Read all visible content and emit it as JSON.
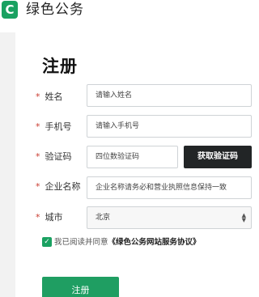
{
  "header": {
    "logo_letter": "C",
    "app_title": "绿色公务",
    "brand_color": "#1aa161"
  },
  "form": {
    "title": "注册",
    "required_mark": "*",
    "fields": [
      {
        "label": "姓名",
        "placeholder": "请输入姓名"
      },
      {
        "label": "手机号",
        "placeholder": "请输入手机号"
      },
      {
        "label": "验证码",
        "placeholder": "四位数验证码"
      },
      {
        "label": "企业名称",
        "placeholder": "企业名称请务必和营业执照信息保持一致"
      },
      {
        "label": "城市",
        "value": "北京"
      }
    ],
    "get_code_button": "获取验证码",
    "agreement": {
      "checked": true,
      "text": "我已阅读并同意",
      "link": "《绿色公务网站服务协议》"
    },
    "submit_button": "注册"
  }
}
